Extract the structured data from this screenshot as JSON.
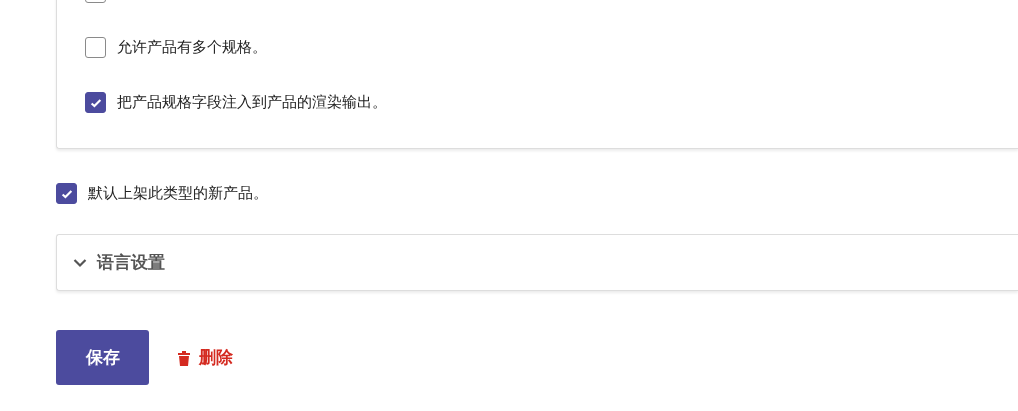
{
  "variant_options": [
    {
      "checked": false
    },
    {
      "label": "允许产品有多个规格。",
      "checked": false
    },
    {
      "label": "把产品规格字段注入到产品的渲染输出。",
      "checked": true
    }
  ],
  "publish_default": {
    "label": "默认上架此类型的新产品。",
    "checked": true
  },
  "language_settings": {
    "title": "语言设置",
    "expanded": false
  },
  "actions": {
    "save": "保存",
    "delete": "删除"
  }
}
